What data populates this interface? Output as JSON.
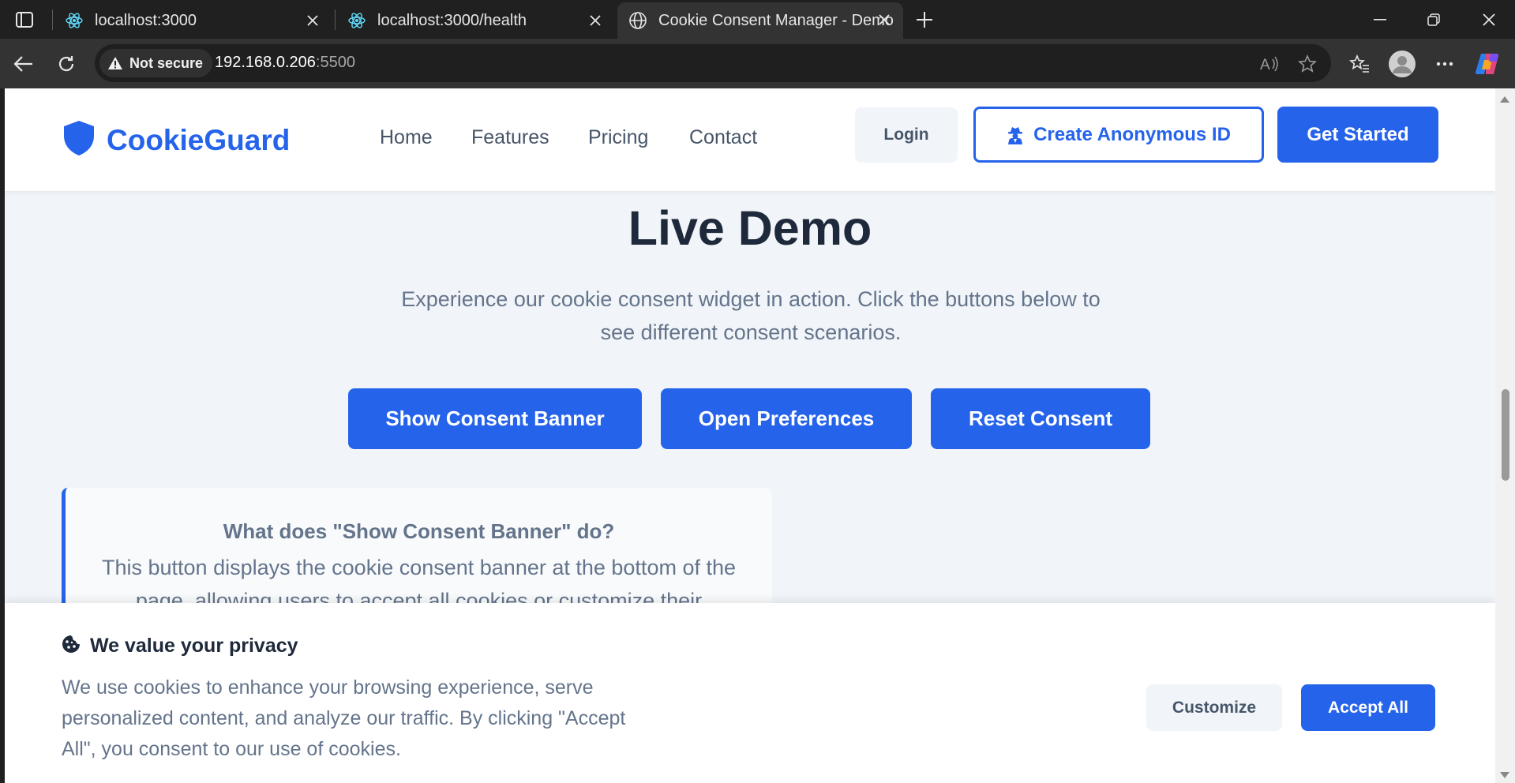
{
  "browser": {
    "tabs": [
      {
        "title": "localhost:3000",
        "favicon": "react-icon"
      },
      {
        "title": "localhost:3000/health",
        "favicon": "react-icon"
      },
      {
        "title": "Cookie Consent Manager - Demo",
        "favicon": "globe-icon"
      }
    ],
    "security_label": "Not secure",
    "url_host": "192.168.0.206",
    "url_port": ":5500"
  },
  "site": {
    "brand": "CookieGuard",
    "nav": [
      "Home",
      "Features",
      "Pricing",
      "Contact"
    ],
    "login_label": "Login",
    "anon_label": "Create Anonymous ID",
    "get_started_label": "Get Started",
    "accent_color": "#2563eb"
  },
  "demo": {
    "title": "Live Demo",
    "subtitle": "Experience our cookie consent widget in action. Click the buttons below to see different consent scenarios.",
    "buttons": [
      "Show Consent Banner",
      "Open Preferences",
      "Reset Consent"
    ],
    "info_title": "What does \"Show Consent Banner\" do?",
    "info_text": "This button displays the cookie consent banner at the bottom of the page, allowing users to accept all cookies or customize their"
  },
  "banner": {
    "title": "We value your privacy",
    "text": "We use cookies to enhance your browsing experience, serve personalized content, and analyze our traffic. By clicking \"Accept All\", you consent to our use of cookies.",
    "customize_label": "Customize",
    "accept_label": "Accept All"
  }
}
